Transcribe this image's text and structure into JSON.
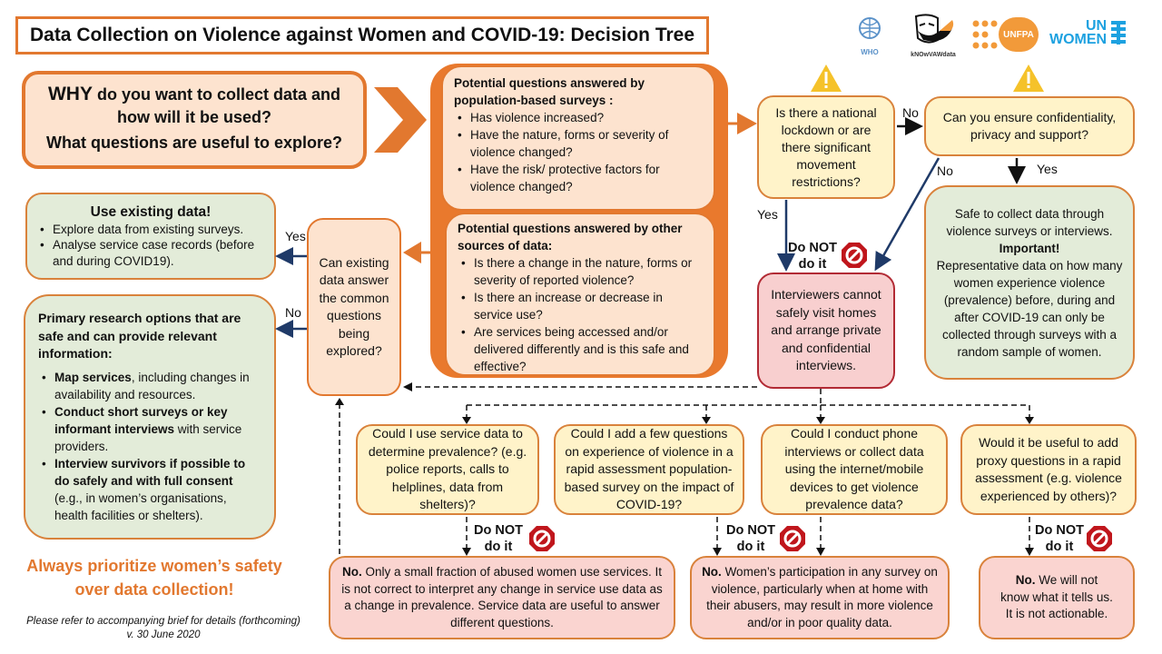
{
  "title": "Data Collection on Violence against Women and COVID-19: Decision Tree",
  "logos": [
    {
      "name": "WHO",
      "label": "WHO"
    },
    {
      "name": "kNOwVAWdata",
      "label": "kNOwVAWdata"
    },
    {
      "name": "UNFPA",
      "label": "UNFPA"
    },
    {
      "name": "UN Women",
      "label_line1": "UN",
      "label_line2": "WOMEN"
    }
  ],
  "why_box": {
    "line1_emph": "WHY",
    "line1_rest": " do you want to collect data and",
    "line2": "how will it be used?",
    "line3": "What questions are useful to explore?"
  },
  "population_surveys": {
    "heading": "Potential questions answered by population-based surveys :",
    "items": [
      "Has violence increased?",
      "Have the nature, forms or severity of violence changed?",
      "Have the risk/ protective factors for violence changed?"
    ]
  },
  "other_sources": {
    "heading": "Potential questions answered by other sources of data:",
    "items": [
      "Is there a change in the nature, forms or severity of reported violence?",
      "Is there an increase or decrease in service use?",
      "Are services being accessed and/or delivered differently and is this safe and effective?"
    ]
  },
  "existing_data_question": "Can existing data answer the common questions being explored?",
  "use_existing": {
    "heading": "Use existing data!",
    "items": [
      "Explore data from existing surveys.",
      "Analyse service case records (before and during COVID19)."
    ]
  },
  "primary_research": {
    "heading": "Primary research options that are safe and can provide relevant information:",
    "items": [
      {
        "bold": "Map services",
        "rest": ", including changes in availability and resources."
      },
      {
        "bold": "Conduct short surveys or key informant interviews",
        "rest": " with service providers."
      },
      {
        "bold": "Interview survivors if possible to do safely and with full consent",
        "rest": " (e.g., in women’s organisations, health facilities or shelters)."
      }
    ]
  },
  "lockdown_question": "Is there a national lockdown or are there significant movement restrictions?",
  "confidentiality_question": "Can you ensure confidentiality, privacy and support?",
  "safe_box": {
    "line1": "Safe to collect data through violence surveys or interviews.",
    "important": "Important!",
    "body": "Representative data on how many women experience violence (prevalence) before, during and after COVID-19 can only be collected through surveys with a random sample of women."
  },
  "interviewers_box": "Interviewers cannot safely visit homes and arrange private and confidential interviews.",
  "labels": {
    "yes": "Yes",
    "no": "No",
    "do_not": "Do NOT",
    "do_it": "do it"
  },
  "bottom_questions": [
    "Could I use service data to determine prevalence? (e.g. police reports, calls to helplines, data from shelters)?",
    "Could I add a few questions on experience of violence in a rapid assessment population-based survey on the impact of COVID-19?",
    "Could I conduct phone interviews or collect data using the internet/mobile devices to get violence prevalence data?",
    "Would it be useful to add proxy questions in a rapid assessment (e.g. violence experienced by others)?"
  ],
  "answers": [
    {
      "bold": "No.",
      "rest": " Only a small fraction of abused women use services. It is not correct to interpret any change in service use data as a change in prevalence. Service data are useful to answer different questions."
    },
    {
      "bold": "No.",
      "rest": " Women’s participation in any survey on violence, particularly when at home with their abusers, may result in more violence and/or in poor quality data."
    },
    {
      "bold": "No.",
      "rest": " We will not know what it tells us. It is not actionable."
    }
  ],
  "safety_note": "Always prioritize women’s safety over data collection!",
  "footer": {
    "line1": "Please refer to accompanying brief for details (forthcoming)",
    "line2": "v. 30 June 2020"
  },
  "colors": {
    "orange": "#e2782f",
    "navy": "#1f3a68",
    "stop_red": "#c0161c",
    "warning_yellow": "#f5c22a",
    "safety_text": "#e2782f"
  }
}
